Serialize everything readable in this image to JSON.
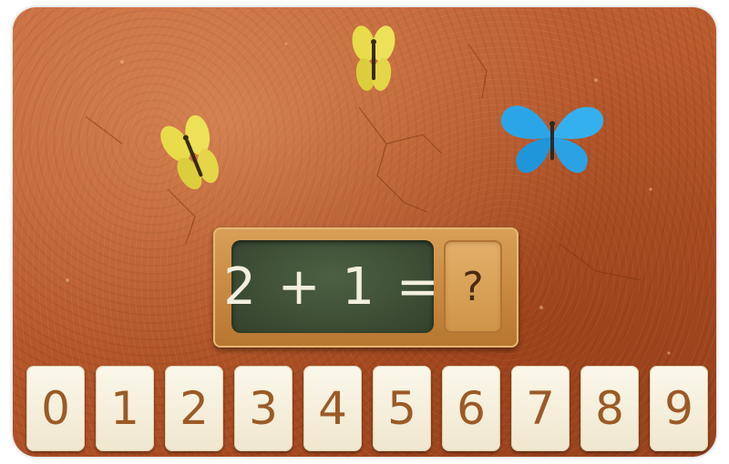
{
  "equation": {
    "text": "2 + 1 =",
    "answer_placeholder": "?"
  },
  "digit_tiles": [
    "0",
    "1",
    "2",
    "3",
    "4",
    "5",
    "6",
    "7",
    "8",
    "9"
  ],
  "butterflies": [
    {
      "name": "yellow-butterfly-top",
      "color": "#e8dc4a"
    },
    {
      "name": "yellow-butterfly-left",
      "color": "#e8dc4a"
    },
    {
      "name": "blue-butterfly",
      "color": "#2aa6e8"
    }
  ],
  "colors": {
    "ground": "#b85a2c",
    "board_wood": "#c98a42",
    "chalkboard": "#3b4b33",
    "chalk": "#f3efdf",
    "tile_bg": "#fbf7ea",
    "tile_digit": "#9b5a26"
  }
}
